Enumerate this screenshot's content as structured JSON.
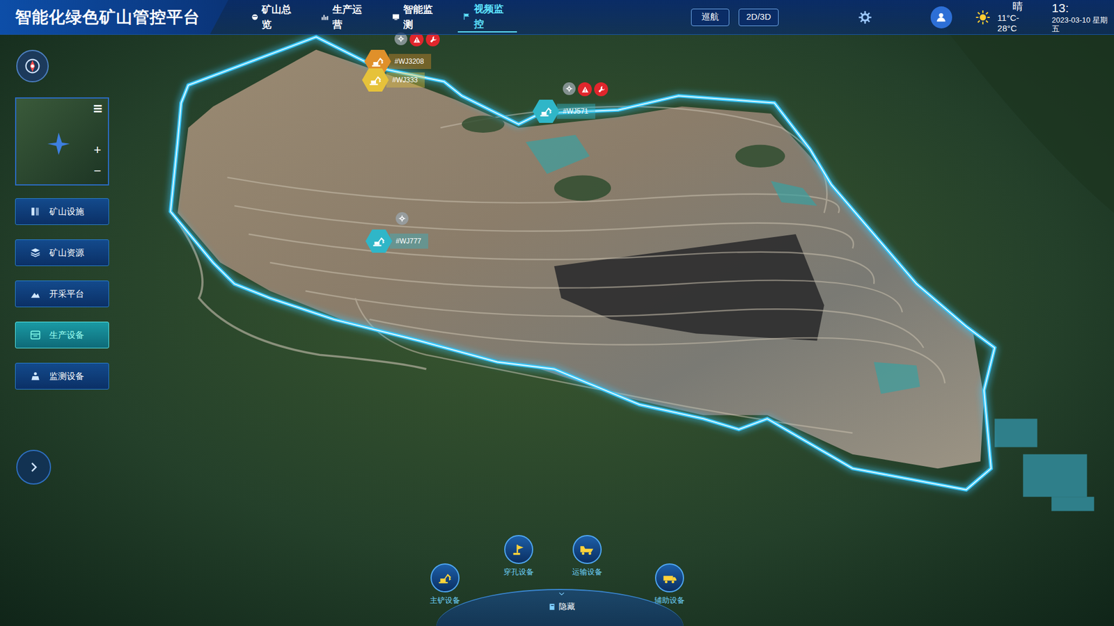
{
  "header": {
    "title": "智能化绿色矿山管控平台",
    "nav": [
      {
        "label": "矿山总览",
        "selected": false
      },
      {
        "label": "生产运营",
        "selected": false
      },
      {
        "label": "智能监测",
        "selected": false
      },
      {
        "label": "视频监控",
        "selected": true
      }
    ],
    "buttons": [
      "巡航",
      "2D/3D"
    ],
    "weather": {
      "condition": "晴",
      "temperature": "11°C-28°C"
    },
    "time": "13:",
    "date": "2023-03-10 星期五"
  },
  "minimap": {
    "list_icon": "☰",
    "zoom_in": "+",
    "zoom_out": "−"
  },
  "sidebar": {
    "items": [
      {
        "label": "矿山设施",
        "selected": false
      },
      {
        "label": "矿山资源",
        "selected": false
      },
      {
        "label": "开采平台",
        "selected": false
      },
      {
        "label": "生产设备",
        "selected": true
      },
      {
        "label": "监测设备",
        "selected": false
      }
    ]
  },
  "markers": [
    {
      "label": "#WJ3208",
      "color": "#e0902a",
      "alert": true,
      "maintenance": true
    },
    {
      "label": "#WJ333",
      "color": "#e6c23a",
      "alert": false,
      "maintenance": false
    },
    {
      "label": "#WJ571",
      "color": "#2fb6c8",
      "alert": true,
      "maintenance": true
    },
    {
      "label": "#WJ777",
      "color": "#2fb6c8",
      "alert": false,
      "maintenance": false
    }
  ],
  "dock": {
    "items": [
      {
        "label": "主铲设备"
      },
      {
        "label": "穿孔设备"
      },
      {
        "label": "运输设备"
      },
      {
        "label": "辅助设备"
      }
    ],
    "hide": "隐藏"
  }
}
